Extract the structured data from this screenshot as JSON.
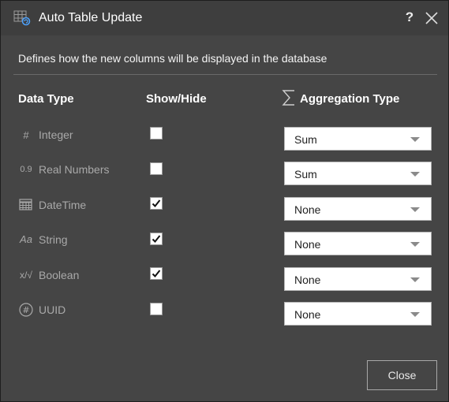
{
  "dialog": {
    "title": "Auto Table Update",
    "help_label": "?",
    "description": "Defines how the new columns will be displayed in the database",
    "close_label": "Close"
  },
  "headers": {
    "data_type": "Data Type",
    "show_hide": "Show/Hide",
    "aggregation_type": "Aggregation Type"
  },
  "rows": [
    {
      "icon": "hash-icon",
      "icon_text": "#",
      "label": "Integer",
      "checked": false,
      "aggregation": "Sum"
    },
    {
      "icon": "decimal-icon",
      "icon_text": "0.9",
      "label": "Real Numbers",
      "checked": false,
      "aggregation": "Sum"
    },
    {
      "icon": "calendar-grid-icon",
      "icon_text": "",
      "label": "DateTime",
      "checked": true,
      "aggregation": "None"
    },
    {
      "icon": "text-aa-icon",
      "icon_text": "Aa",
      "label": "String",
      "checked": true,
      "aggregation": "None"
    },
    {
      "icon": "boolean-icon",
      "icon_text": "x/√",
      "label": "Boolean",
      "checked": true,
      "aggregation": "None"
    },
    {
      "icon": "uuid-hash-circle-icon",
      "icon_text": "#",
      "label": "UUID",
      "checked": false,
      "aggregation": "None"
    }
  ],
  "colors": {
    "background": "#454545",
    "text_muted": "#a9a9a9",
    "text": "#ffffff"
  }
}
